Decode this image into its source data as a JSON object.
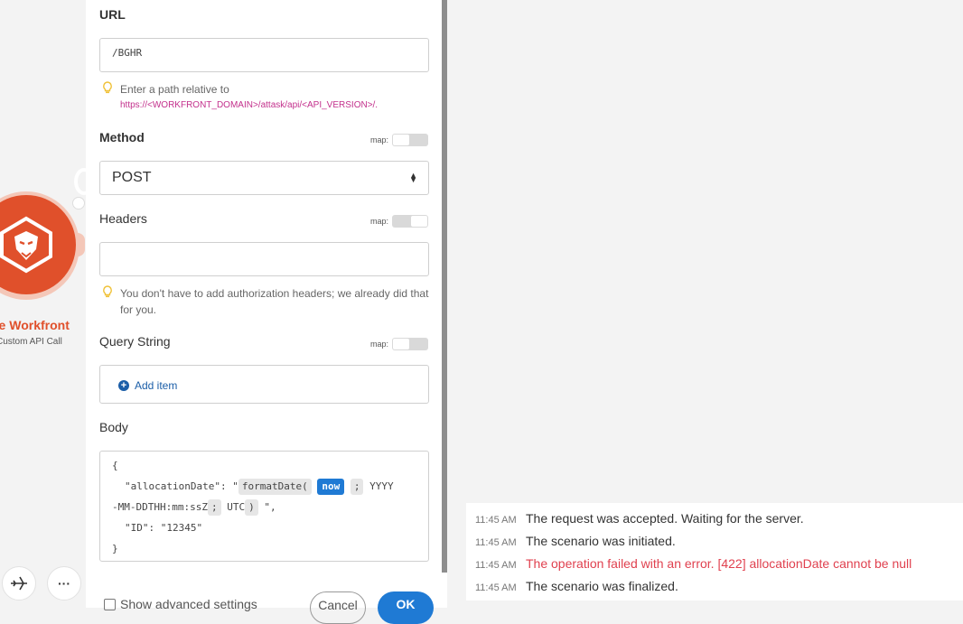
{
  "node": {
    "title": "be Workfront",
    "subtitle": "Custom API Call",
    "icon": "lion-logo-icon",
    "color": "#e0502b"
  },
  "bottom_toolbar": {
    "buttons": [
      {
        "icon": "airplane-icon"
      },
      {
        "icon": "more-icon",
        "glyph": "···"
      }
    ]
  },
  "panel": {
    "url": {
      "label": "URL",
      "value": "/BGHR",
      "hint_text": "Enter a path relative to",
      "hint_link": "https://<WORKFRONT_DOMAIN>/attask/api/<API_VERSION>/."
    },
    "method": {
      "label": "Method",
      "map_label": "map:",
      "value": "POST"
    },
    "headers": {
      "label": "Headers",
      "map_label": "map:",
      "hint": "You don't have to add authorization headers; we already did that for you."
    },
    "query_string": {
      "label": "Query String",
      "map_label": "map:",
      "add_item": "Add item"
    },
    "body": {
      "label": "Body",
      "line1": "{",
      "line2_key": "\"allocationDate\": \"",
      "fn_name": "formatDate(",
      "fn_arg_now": "now",
      "sep1": ";",
      "format_a": "YYYY",
      "format_b": "-MM-DDTHH:mm:ssZ",
      "sep2": ";",
      "tz": "UTC",
      "close_paren": ")",
      "line3_end": "\",",
      "line4": "\"ID\": \"12345\"",
      "line5": "}"
    },
    "footer": {
      "show_advanced": "Show advanced settings",
      "cancel": "Cancel",
      "ok": "OK"
    }
  },
  "log": {
    "entries": [
      {
        "time": "11:45 AM",
        "message": "The request was accepted. Waiting for the server.",
        "status": "info"
      },
      {
        "time": "11:45 AM",
        "message": "The scenario was initiated.",
        "status": "info"
      },
      {
        "time": "11:45 AM",
        "message": "The operation failed with an error. [422] allocationDate cannot be null",
        "status": "error"
      },
      {
        "time": "11:45 AM",
        "message": "The scenario was finalized.",
        "status": "info"
      }
    ]
  }
}
